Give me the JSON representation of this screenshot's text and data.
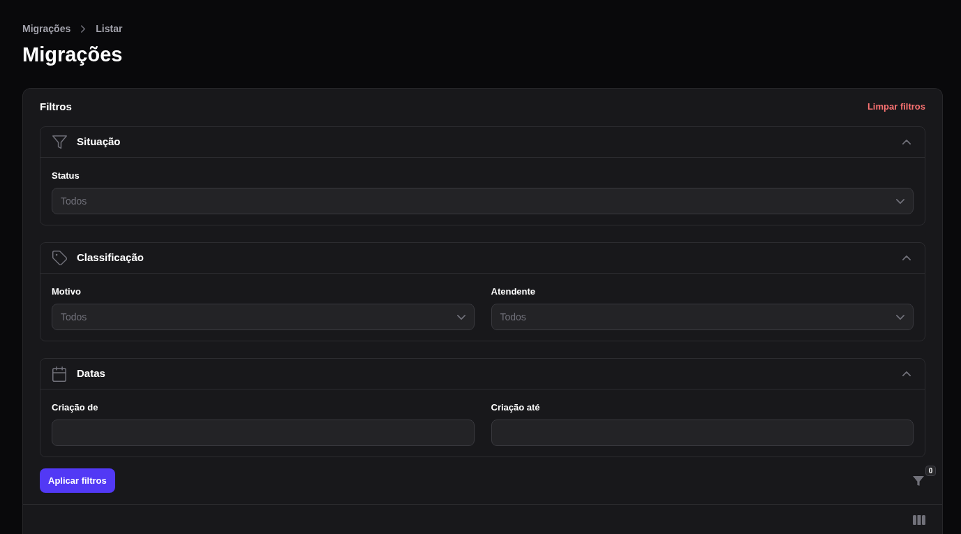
{
  "breadcrumbs": [
    {
      "label": "Migrações"
    },
    {
      "label": "Listar"
    }
  ],
  "title": "Migrações",
  "filters": {
    "title": "Filtros",
    "clear_label": "Limpar filtros",
    "sections": [
      {
        "kind": "status",
        "title": "Situação",
        "expanded": true,
        "fields": [
          {
            "kind": "select",
            "label": "Status",
            "placeholder": "Todos"
          }
        ]
      },
      {
        "kind": "category",
        "title": "Classificação",
        "expanded": true,
        "fields": [
          {
            "kind": "select",
            "label": "Motivo",
            "placeholder": "Todos"
          },
          {
            "kind": "select",
            "label": "Atendente",
            "placeholder": "Todos"
          }
        ]
      },
      {
        "kind": "date",
        "title": "Datas",
        "expanded": true,
        "fields": [
          {
            "kind": "date",
            "label": "Criação de"
          },
          {
            "kind": "date",
            "label": "Criação até"
          }
        ]
      }
    ],
    "apply_label": "Aplicar filtros",
    "active_count": "0"
  }
}
